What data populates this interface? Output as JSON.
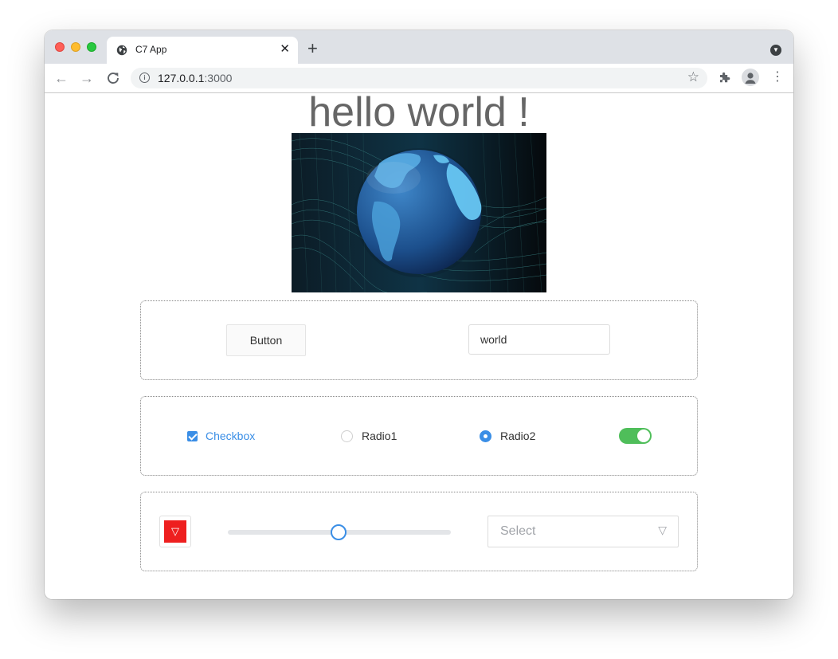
{
  "browser": {
    "tab_title": "C7 App",
    "tab_close": "✕",
    "new_tab": "+",
    "url_host": "127.0.0.1",
    "url_port": ":3000",
    "icons": [
      "globe-icon",
      "back-arrow-icon",
      "forward-arrow-icon",
      "reload-icon",
      "info-icon",
      "star-icon",
      "puzzle-icon",
      "profile-icon",
      "more-icon",
      "tab-menu-icon"
    ]
  },
  "page": {
    "heading": "hello world !",
    "hero_image": "globe-image",
    "button_label": "Button",
    "input_value": "world",
    "checkbox_label": "Checkbox",
    "checkbox_checked": true,
    "radio1_label": "Radio1",
    "radio1_selected": false,
    "radio2_label": "Radio2",
    "radio2_selected": true,
    "switch_on": true,
    "dropdown_icon": "▽",
    "slider_value": 0.5,
    "select_placeholder": "Select",
    "select_arrow": "▽"
  },
  "colors": {
    "accent": "#3a8ee6",
    "switch_on": "#4fbe5a",
    "dropdown_button": "#ee1f1f",
    "heading": "#666666"
  }
}
